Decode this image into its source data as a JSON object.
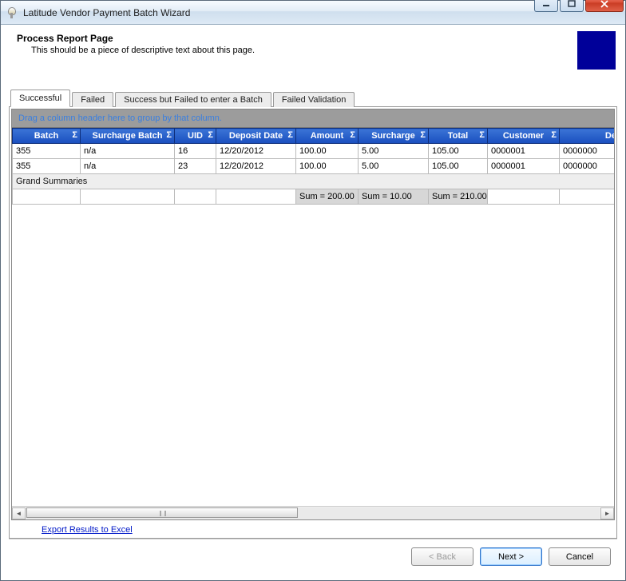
{
  "window": {
    "title": "Latitude Vendor Payment Batch Wizard"
  },
  "header": {
    "title": "Process Report Page",
    "subtitle": "This should be a piece of descriptive text about this page."
  },
  "tabs": [
    {
      "label": "Successful",
      "active": true
    },
    {
      "label": "Failed",
      "active": false
    },
    {
      "label": "Success but Failed to enter a Batch",
      "active": false
    },
    {
      "label": "Failed Validation",
      "active": false
    }
  ],
  "grid": {
    "groupby_hint": "Drag a column header here to group by that column.",
    "columns": [
      "Batch",
      "Surcharge Batch",
      "UID",
      "Deposit Date",
      "Amount",
      "Surcharge",
      "Total",
      "Customer",
      "Des"
    ],
    "rows": [
      {
        "batch": "355",
        "surcharge_batch": "n/a",
        "uid": "16",
        "deposit_date": "12/20/2012",
        "amount": "100.00",
        "surcharge": "5.00",
        "total": "105.00",
        "customer": "0000001",
        "desc": "0000000"
      },
      {
        "batch": "355",
        "surcharge_batch": "n/a",
        "uid": "23",
        "deposit_date": "12/20/2012",
        "amount": "100.00",
        "surcharge": "5.00",
        "total": "105.00",
        "customer": "0000001",
        "desc": "0000000"
      }
    ],
    "summary_label": "Grand Summaries",
    "summaries": {
      "amount": "Sum = 200.00",
      "surcharge": "Sum = 10.00",
      "total": "Sum = 210.00"
    }
  },
  "export_link": "Export Results to Excel",
  "buttons": {
    "back": "< Back",
    "next": "Next >",
    "cancel": "Cancel"
  }
}
